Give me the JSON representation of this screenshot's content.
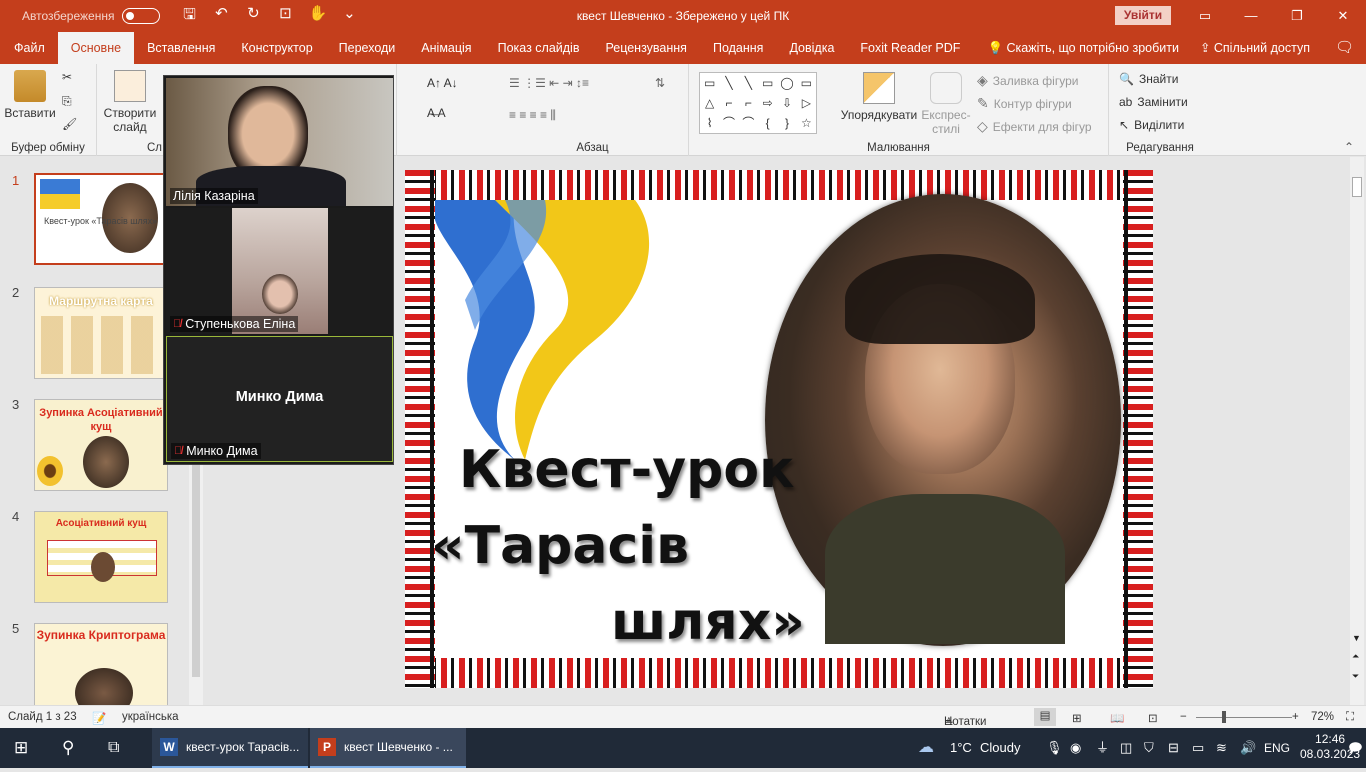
{
  "titlebar": {
    "autosave_label": "Автозбереження",
    "document_title": "квест Шевченко  -  Збережено у цей ПК",
    "signin_label": "Увійти"
  },
  "tabs": [
    "Файл",
    "Основне",
    "Вставлення",
    "Конструктор",
    "Переходи",
    "Анімація",
    "Показ слайдів",
    "Рецензування",
    "Подання",
    "Довідка",
    "Foxit Reader PDF"
  ],
  "tell_me": "Скажіть, що потрібно зробити",
  "share_label": "Спільний доступ",
  "ribbon": {
    "paste_label": "Вставити",
    "clipboard_group": "Буфер обміну",
    "new_slide_label": "Створити слайд",
    "slides_group_partial": "Сл",
    "paragraph_group": "Абзац",
    "arrange_label": "Упорядкувати",
    "quick_styles_label": "Експрес-стилі",
    "shape_fill_label": "Заливка фігури",
    "shape_outline_label": "Контур фігури",
    "shape_effects_label": "Ефекти для фігур",
    "drawing_group": "Малювання",
    "find_label": "Знайти",
    "replace_label": "Замінити",
    "select_label": "Виділити",
    "editing_group": "Редагування"
  },
  "thumbnails": [
    {
      "num": "1",
      "title": "Квест-урок «Тарасів шлях»",
      "selected": true
    },
    {
      "num": "2",
      "title": "Маршрутна карта",
      "selected": false
    },
    {
      "num": "3",
      "title": "Зупинка Асоціативний кущ",
      "selected": false
    },
    {
      "num": "4",
      "title": "Асоціативний кущ",
      "selected": false
    },
    {
      "num": "5",
      "title": "Зупинка Криптограма",
      "selected": false
    }
  ],
  "video": {
    "participants": [
      {
        "name": "Лілія Казаріна",
        "muted": false
      },
      {
        "name": "Ступенькова Еліна",
        "muted": true
      },
      {
        "name": "Минко Дима",
        "muted": true,
        "placeholder": "Минко Дима"
      }
    ]
  },
  "slide": {
    "line1": "Квест-урок",
    "line2": "«Тарасів",
    "line3": "шлях»"
  },
  "statusbar": {
    "slide_info": "Слайд 1 з 23",
    "language": "українська",
    "notes_label": "Нотатки",
    "zoom": "72%"
  },
  "taskbar": {
    "app1": "квест-урок Тарасів...",
    "app2": "квест Шевченко - ...",
    "weather_temp": "1°C",
    "weather_desc": "Cloudy",
    "lang": "ENG",
    "time": "12:46",
    "date": "08.03.2023"
  },
  "colors": {
    "accent": "#c43e1c",
    "taskbar": "#202a38",
    "ornament_red": "#d81f1f"
  }
}
